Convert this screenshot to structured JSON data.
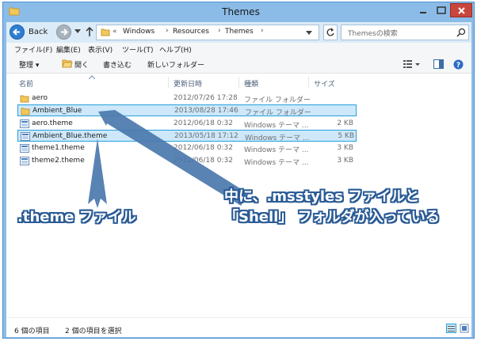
{
  "window": {
    "title": "Themes",
    "titlebar_color": "#8bbce8",
    "close_color": "#c9463d"
  },
  "nav": {
    "back_label": "Back",
    "address_chevron": "«",
    "breadcrumbs": [
      "Windows",
      "Resources",
      "Themes"
    ],
    "search_placeholder": "Themesの検索"
  },
  "menu": {
    "items": [
      "ファイル(F)",
      "編集(E)",
      "表示(V)",
      "ツール(T)",
      "ヘルプ(H)"
    ]
  },
  "toolbar": {
    "organize": "整理 ▾",
    "open": "開く",
    "burn": "書き込む",
    "new_folder": "新しいフォルダー",
    "view_icon": "view-options-icon",
    "pane_icon": "preview-pane-icon",
    "help_icon": "help-icon"
  },
  "columns": {
    "name": "名前",
    "date": "更新日時",
    "type": "種類",
    "size": "サイズ"
  },
  "files": [
    {
      "name": "aero",
      "date": "2012/07/26 17:28",
      "type": "ファイル フォルダー",
      "size": "",
      "icon": "folder-icon",
      "selected": false
    },
    {
      "name": "Ambient_Blue",
      "date": "2013/08/28 17:46",
      "type": "ファイル フォルダー",
      "size": "",
      "icon": "folder-icon",
      "selected": true
    },
    {
      "name": "aero.theme",
      "date": "2012/06/18 0:32",
      "type": "Windows テーマ ...",
      "size": "2 KB",
      "icon": "theme-file-icon",
      "selected": false
    },
    {
      "name": "Ambient_Blue.theme",
      "date": "2013/05/18 17:12",
      "type": "Windows テーマ ...",
      "size": "5 KB",
      "icon": "theme-file-icon",
      "selected": true
    },
    {
      "name": "theme1.theme",
      "date": "2012/06/18 0:32",
      "type": "Windows テーマ ...",
      "size": "3 KB",
      "icon": "theme-file-icon",
      "selected": false
    },
    {
      "name": "theme2.theme",
      "date": "2012/06/18 0:32",
      "type": "Windows テーマ ...",
      "size": "3 KB",
      "icon": "theme-file-icon",
      "selected": false
    }
  ],
  "annotations": {
    "theme_file": ".theme ファイル",
    "folder_contents_line1": "中に、.msstyles ファイルと",
    "folder_contents_line2": "「Shell」 フォルダが入っている",
    "arrow_color": "#4a78ad",
    "text_color": "#ffffff"
  },
  "status": {
    "item_count": "6 個の項目",
    "selected_count": "2 個の項目を選択"
  }
}
